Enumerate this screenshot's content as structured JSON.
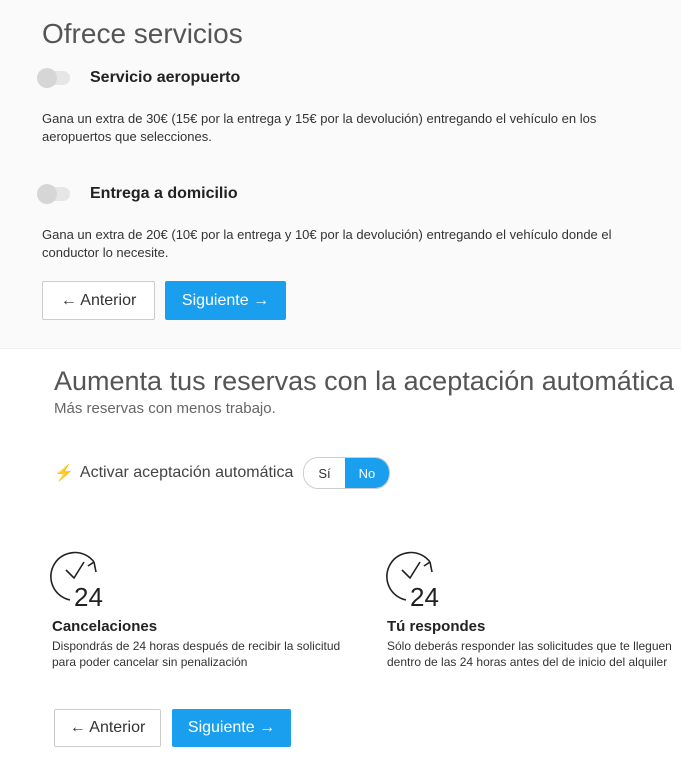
{
  "services": {
    "title": "Ofrece servicios",
    "airport": {
      "label": "Servicio aeropuerto",
      "description": "Gana un extra de 30€ (15€ por la entrega y 15€ por la devolución) entregando el vehículo en los aeropuertos que selecciones.",
      "enabled": false
    },
    "home_delivery": {
      "label": "Entrega a domicilio",
      "description": "Gana un extra de 20€ (10€ por la entrega y 10€ por la devolución) entregando el vehículo donde el conductor lo necesite.",
      "enabled": false
    },
    "prev_label": "← Anterior",
    "next_label": "Siguiente →"
  },
  "auto_accept": {
    "title": "Aumenta tus reservas con la aceptación automática",
    "subtitle": "Más reservas con menos trabajo.",
    "toggle_label": "Activar aceptación automática",
    "option_yes": "Sí",
    "option_no": "No",
    "selected": "No",
    "features": [
      {
        "icon": "clock-24-icon",
        "title": "Cancelaciones",
        "text": "Dispondrás de 24 horas después de recibir la solicitud para poder cancelar sin penalización"
      },
      {
        "icon": "clock-24-icon",
        "title": "Tú respondes",
        "text": "Sólo deberás responder las solicitudes que te lleguen dentro de las 24 horas antes del de inicio del alquiler"
      }
    ],
    "prev_label": "← Anterior",
    "next_label": "Siguiente →"
  },
  "colors": {
    "primary": "#1a9fef",
    "accent_bolt": "#f5b82e"
  }
}
